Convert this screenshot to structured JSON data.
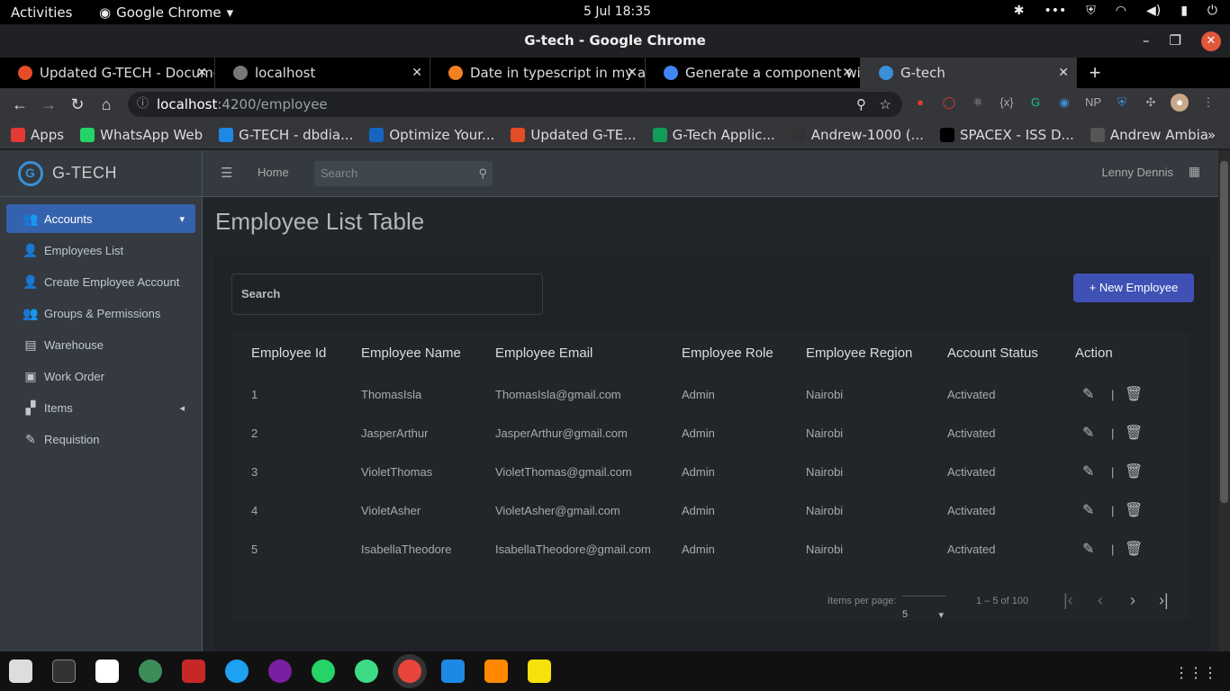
{
  "gnome": {
    "activities": "Activities",
    "app": "Google Chrome",
    "clock": "5 Jul  18:35"
  },
  "window": {
    "title": "G-tech - Google Chrome"
  },
  "tabs": [
    {
      "title": "Updated G-TECH - Docume",
      "color": "#e44d26"
    },
    {
      "title": "localhost",
      "color": "#777"
    },
    {
      "title": "Date in typescript in my ar",
      "color": "#f48024"
    },
    {
      "title": "Generate a component wi",
      "color": "#4285f4"
    },
    {
      "title": "G-tech",
      "color": "#3a8fd6"
    }
  ],
  "address": {
    "host": "localhost",
    "path": ":4200/employee"
  },
  "bookmarks": [
    {
      "label": "Apps",
      "color": "#e53935"
    },
    {
      "label": "WhatsApp Web",
      "color": "#25d366"
    },
    {
      "label": "G-TECH - dbdia...",
      "color": "#1e88e5"
    },
    {
      "label": "Optimize Your...",
      "color": "#1565c0"
    },
    {
      "label": "Updated G-TE...",
      "color": "#e44d26"
    },
    {
      "label": "G-Tech Applic...",
      "color": "#0f9d58"
    },
    {
      "label": "Andrew-1000 (...",
      "color": "#333"
    },
    {
      "label": "SPACEX - ISS D...",
      "color": "#000"
    },
    {
      "label": "Andrew Ambia",
      "color": "#555"
    }
  ],
  "sidebar": {
    "brand": "G-TECH",
    "items": [
      {
        "label": "Accounts",
        "icon": "users-icon"
      },
      {
        "label": "Employees List",
        "icon": "user-plus-icon"
      },
      {
        "label": "Create Employee Account",
        "icon": "user-plus-icon"
      },
      {
        "label": "Groups & Permissions",
        "icon": "users-icon"
      },
      {
        "label": "Warehouse",
        "icon": "warehouse-icon"
      },
      {
        "label": "Work Order",
        "icon": "briefcase-icon"
      },
      {
        "label": "Items",
        "icon": "items-icon"
      },
      {
        "label": "Requistion",
        "icon": "edit-icon"
      }
    ]
  },
  "topnav": {
    "home": "Home",
    "search_placeholder": "Search",
    "user": "Lenny Dennis"
  },
  "page": {
    "title": "Employee List Table",
    "search_placeholder": "Search",
    "new_button": "New Employee"
  },
  "table": {
    "headers": [
      "Employee Id",
      "Employee Name",
      "Employee Email",
      "Employee Role",
      "Employee Region",
      "Account Status",
      "Action"
    ],
    "rows": [
      {
        "id": "1",
        "name": "ThomasIsla",
        "email": "ThomasIsla@gmail.com",
        "role": "Admin",
        "region": "Nairobi",
        "status": "Activated"
      },
      {
        "id": "2",
        "name": "JasperArthur",
        "email": "JasperArthur@gmail.com",
        "role": "Admin",
        "region": "Nairobi",
        "status": "Activated"
      },
      {
        "id": "3",
        "name": "VioletThomas",
        "email": "VioletThomas@gmail.com",
        "role": "Admin",
        "region": "Nairobi",
        "status": "Activated"
      },
      {
        "id": "4",
        "name": "VioletAsher",
        "email": "VioletAsher@gmail.com",
        "role": "Admin",
        "region": "Nairobi",
        "status": "Activated"
      },
      {
        "id": "5",
        "name": "IsabellaTheodore",
        "email": "IsabellaTheodore@gmail.com",
        "role": "Admin",
        "region": "Nairobi",
        "status": "Activated"
      }
    ]
  },
  "paginator": {
    "items_label": "Items per page:",
    "page_size": "5",
    "range": "1 – 5 of 100"
  }
}
